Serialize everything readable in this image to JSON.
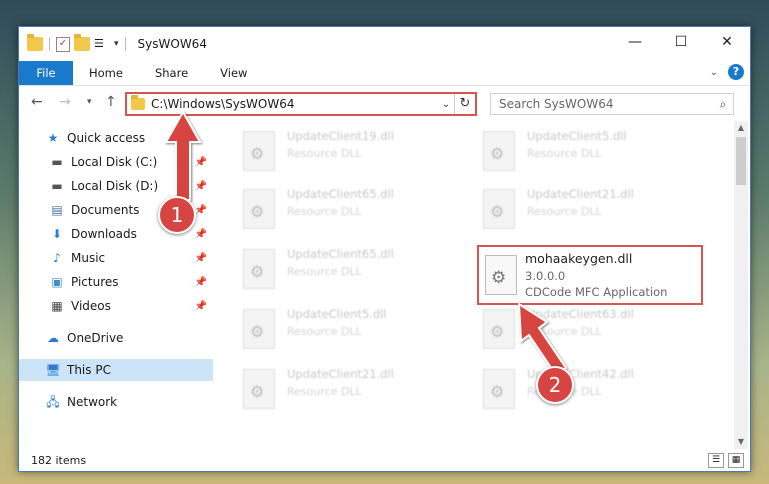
{
  "window": {
    "title": "SysWOW64",
    "controls": {
      "minimize": "—",
      "maximize": "☐",
      "close": "✕"
    }
  },
  "ribbon": {
    "tabs": [
      "File",
      "Home",
      "Share",
      "View"
    ]
  },
  "address": {
    "path": "C:\\Windows\\SysWOW64",
    "search_placeholder": "Search SysWOW64"
  },
  "nav": {
    "items": [
      {
        "label": "Quick access",
        "icon": "star-icon"
      },
      {
        "label": "Local Disk (C:)",
        "icon": "drive-icon",
        "pinned": true
      },
      {
        "label": "Local Disk (D:)",
        "icon": "drive-icon",
        "pinned": true
      },
      {
        "label": "Documents",
        "icon": "documents-icon",
        "pinned": true
      },
      {
        "label": "Downloads",
        "icon": "download-icon",
        "pinned": true
      },
      {
        "label": "Music",
        "icon": "music-icon",
        "pinned": true
      },
      {
        "label": "Pictures",
        "icon": "pictures-icon",
        "pinned": true
      },
      {
        "label": "Videos",
        "icon": "video-icon",
        "pinned": true
      },
      {
        "label": "OneDrive",
        "icon": "cloud-icon"
      },
      {
        "label": "This PC",
        "icon": "computer-icon",
        "selected": true
      },
      {
        "label": "Network",
        "icon": "network-icon"
      }
    ]
  },
  "files": [
    {
      "name": "UpdateClient19.dll",
      "desc": "Resource DLL"
    },
    {
      "name": "UpdateClient5.dll",
      "desc": "Resource DLL"
    },
    {
      "name": "UpdateClient65.dll",
      "desc": "Resource DLL"
    },
    {
      "name": "UpdateClient21.dll",
      "desc": "Resource DLL"
    },
    {
      "name": "UpdateClient65.dll",
      "desc": "Resource DLL"
    },
    {
      "name": "UpdateClient5.dll",
      "desc": "Resource DLL"
    },
    {
      "name": "UpdateClient63.dll",
      "desc": "Resource DLL"
    },
    {
      "name": "UpdateClient21.dll",
      "desc": "Resource DLL"
    },
    {
      "name": "UpdateClient42.dll",
      "desc": "Resource DLL"
    }
  ],
  "highlighted_file": {
    "name": "mohaakeygen.dll",
    "version": "3.0.0.0",
    "desc": "CDCode MFC Application"
  },
  "status": {
    "count": "182 items"
  },
  "annotations": {
    "badge1": "1",
    "badge2": "2",
    "color": "#d64541"
  }
}
